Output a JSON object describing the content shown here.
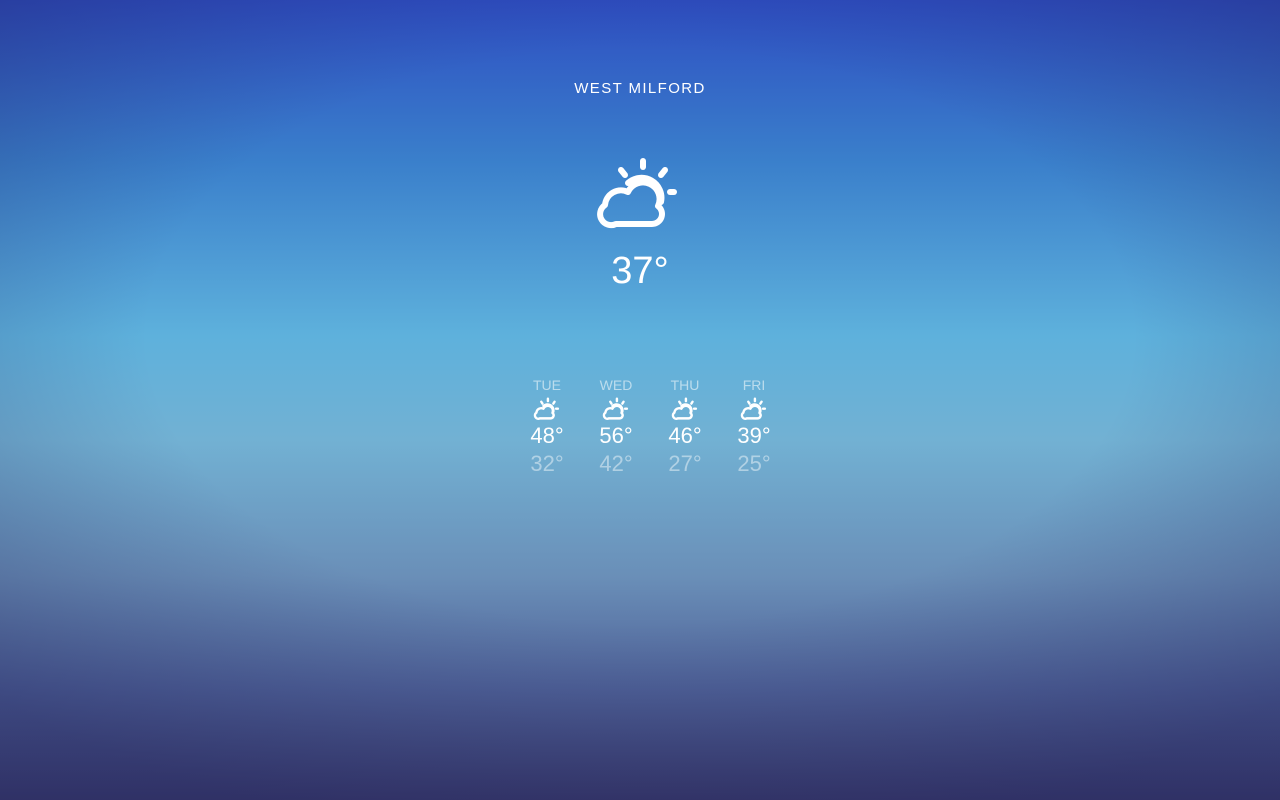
{
  "location": {
    "name": "WEST MILFORD"
  },
  "current": {
    "icon": "partly-cloudy-icon",
    "temperature": "37°"
  },
  "forecast": [
    {
      "day": "TUE",
      "icon": "partly-cloudy-icon",
      "high": "48°",
      "low": "32°"
    },
    {
      "day": "WED",
      "icon": "partly-cloudy-icon",
      "high": "56°",
      "low": "42°"
    },
    {
      "day": "THU",
      "icon": "partly-cloudy-icon",
      "high": "46°",
      "low": "27°"
    },
    {
      "day": "FRI",
      "icon": "partly-cloudy-icon",
      "high": "39°",
      "low": "25°"
    }
  ],
  "colors": {
    "background_top": "#2e4ec2",
    "background_mid": "#5eb1dc",
    "background_bottom": "#393b6c",
    "text": "#ffffff"
  }
}
